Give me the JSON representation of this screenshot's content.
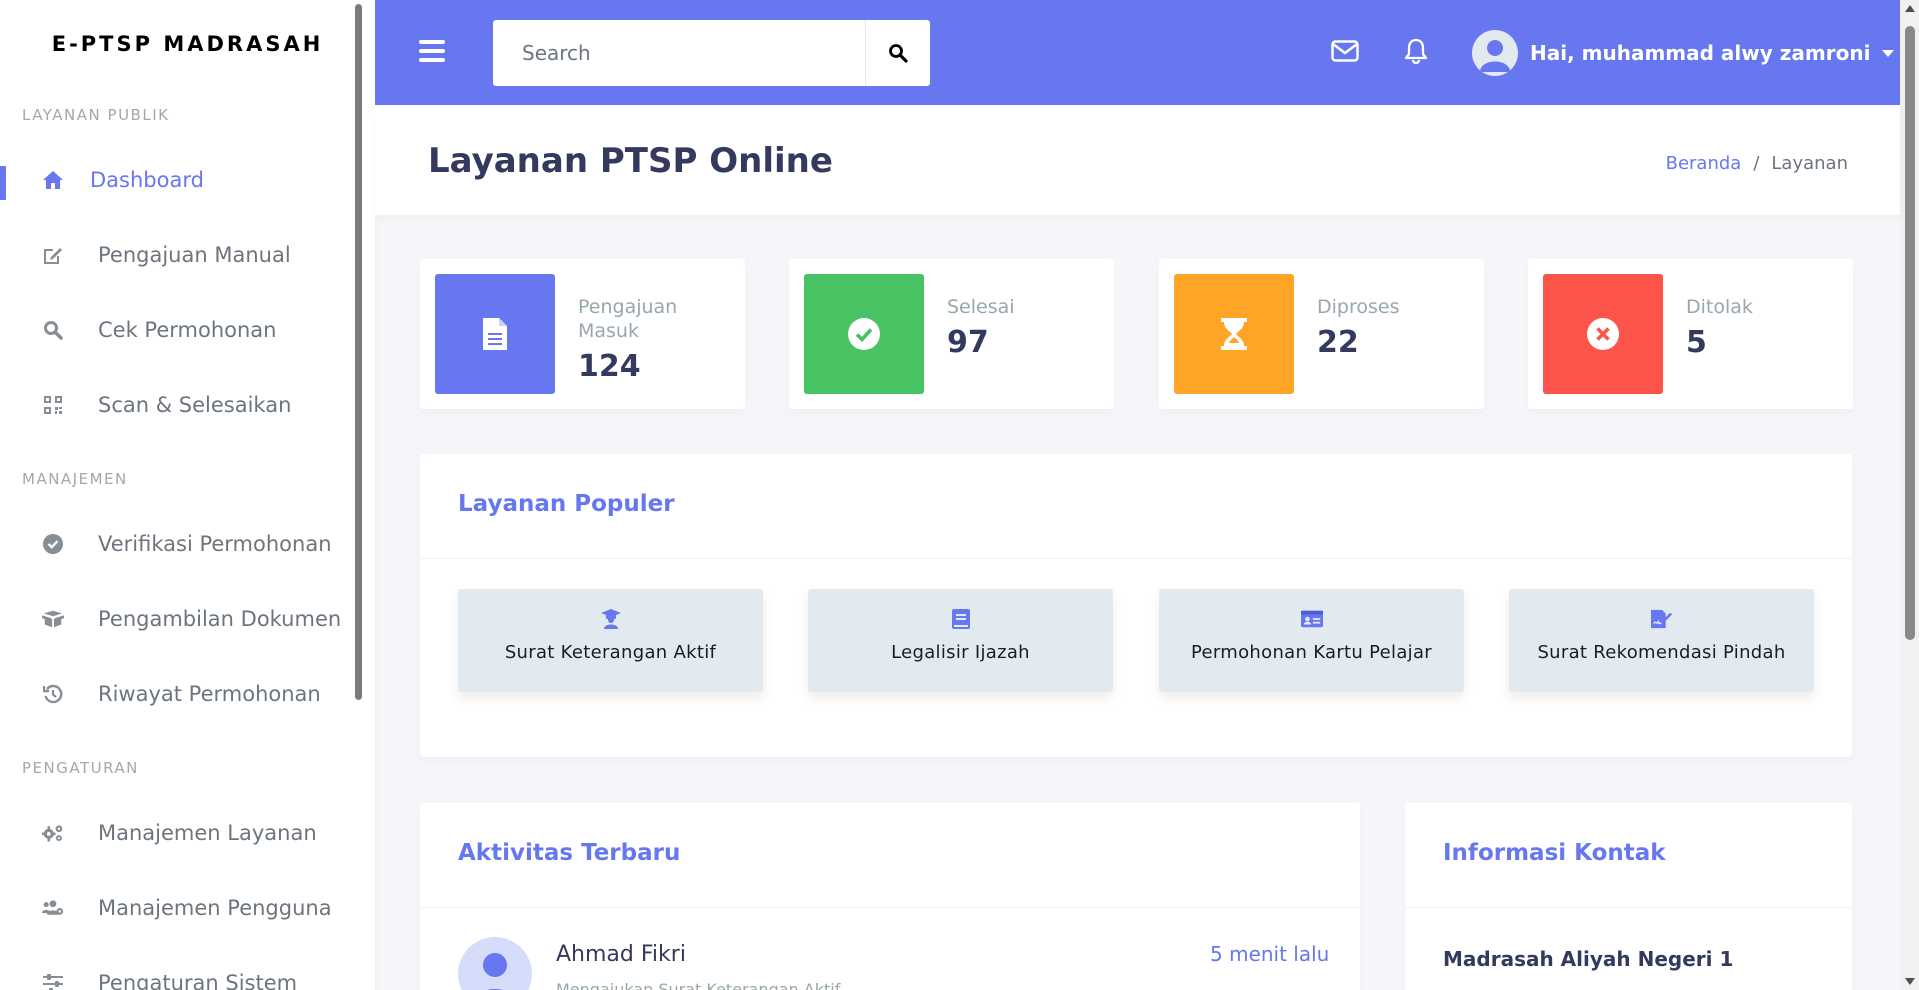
{
  "brand": "E-PTSP MADRASAH",
  "sidebar": {
    "sections": [
      {
        "header": "LAYANAN PUBLIK",
        "items": [
          {
            "label": "Dashboard",
            "icon": "home-icon"
          },
          {
            "label": "Pengajuan Manual",
            "icon": "edit-icon"
          },
          {
            "label": "Cek Permohonan",
            "icon": "search-icon"
          },
          {
            "label": "Scan & Selesaikan",
            "icon": "qrcode-icon"
          }
        ]
      },
      {
        "header": "MANAJEMEN",
        "items": [
          {
            "label": "Verifikasi Permohonan",
            "icon": "check-circle-icon"
          },
          {
            "label": "Pengambilan Dokumen",
            "icon": "box-open-icon"
          },
          {
            "label": "Riwayat Permohonan",
            "icon": "history-icon"
          }
        ]
      },
      {
        "header": "PENGATURAN",
        "items": [
          {
            "label": "Manajemen Layanan",
            "icon": "cogs-icon"
          },
          {
            "label": "Manajemen Pengguna",
            "icon": "users-cog-icon"
          },
          {
            "label": "Pengaturan Sistem",
            "icon": "sliders-icon"
          }
        ]
      }
    ]
  },
  "navbar": {
    "search_placeholder": "Search",
    "user_greeting": "Hai, muhammad alwy zamroni"
  },
  "page": {
    "title": "Layanan PTSP Online",
    "breadcrumb": [
      "Beranda",
      "/",
      "Layanan"
    ]
  },
  "stats": [
    {
      "label": "Pengajuan Masuk",
      "value": "124",
      "color": "#6777ef",
      "icon": "file-icon"
    },
    {
      "label": "Selesai",
      "value": "97",
      "color": "#47c363",
      "icon": "check-circle-icon"
    },
    {
      "label": "Diproses",
      "value": "22",
      "color": "#ffa426",
      "icon": "hourglass-icon"
    },
    {
      "label": "Ditolak",
      "value": "5",
      "color": "#fc544b",
      "icon": "times-circle-icon"
    }
  ],
  "popular": {
    "title": "Layanan Populer",
    "items": [
      {
        "label": "Surat Keterangan Aktif",
        "icon": "graduate-icon"
      },
      {
        "label": "Legalisir Ijazah",
        "icon": "book-icon"
      },
      {
        "label": "Permohonan Kartu Pelajar",
        "icon": "id-card-icon"
      },
      {
        "label": "Surat Rekomendasi Pindah",
        "icon": "file-signature-icon"
      }
    ]
  },
  "activity": {
    "title": "Aktivitas Terbaru",
    "items": [
      {
        "name": "Ahmad Fikri",
        "time": "5 menit lalu",
        "desc": "Mengajukan Surat Keterangan Aktif"
      }
    ]
  },
  "contact": {
    "title": "Informasi Kontak",
    "name": "Madrasah Aliyah Negeri 1"
  },
  "colors": {
    "primary": "#6777ef",
    "success": "#47c363",
    "warning": "#ffa426",
    "danger": "#fc544b"
  }
}
